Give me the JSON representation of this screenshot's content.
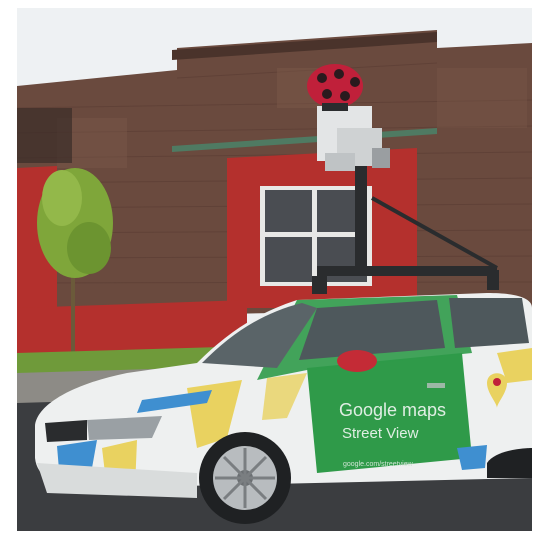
{
  "photo": {
    "subject_text": {
      "brand": "Google maps",
      "product": "Street View",
      "url": "google.com/streetview"
    },
    "colors": {
      "sky": "#eef1f3",
      "brick": "#6a4a3e",
      "brick_dark": "#5a3c33",
      "red_wall": "#b4302d",
      "car_white": "#eef0f0",
      "car_green": "#2f9a49",
      "car_yellow": "#e9d260",
      "car_blue": "#3f8fd0",
      "road": "#3b3d40",
      "grass": "#6f9a3a",
      "camera_red": "#c0203a"
    }
  }
}
